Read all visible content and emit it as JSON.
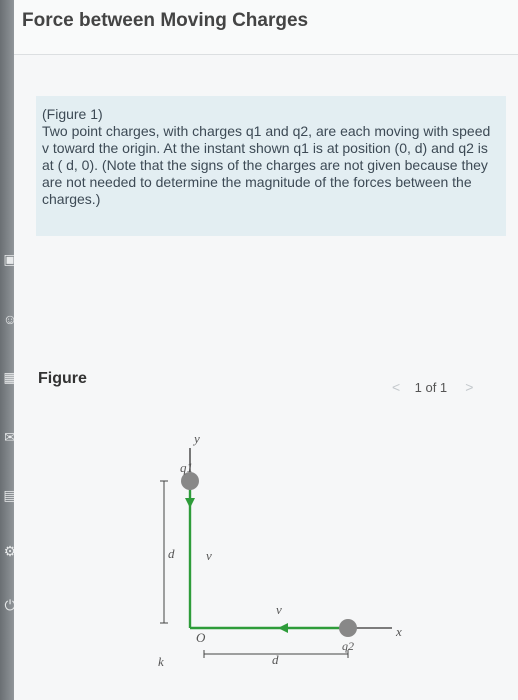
{
  "header": {
    "title": "Force between Moving Charges"
  },
  "problem": {
    "figure_ref": "(Figure 1)",
    "body": "Two point charges, with charges q1 and q2, are each moving with speed v toward the origin. At the instant shown q1 is at position (0, d) and q2 is at ( d, 0). (Note that the signs of the charges are not given because they are not needed to determine the magnitude of the forces between the charges.)"
  },
  "figure": {
    "label": "Figure",
    "pager_text": "1 of 1",
    "prev_symbol": "<",
    "next_symbol": ">",
    "diagram": {
      "y_axis": "y",
      "x_axis": "x",
      "origin": "O",
      "q1": "q1",
      "q2": "q2",
      "v1": "v",
      "v2": "v",
      "d_vertical": "d",
      "d_horizontal": "d",
      "k": "k"
    }
  },
  "rail": {
    "icons": [
      "calculator-icon",
      "users-icon",
      "grid-icon",
      "mail-icon",
      "book-icon",
      "gear-icon",
      "power-icon"
    ]
  }
}
